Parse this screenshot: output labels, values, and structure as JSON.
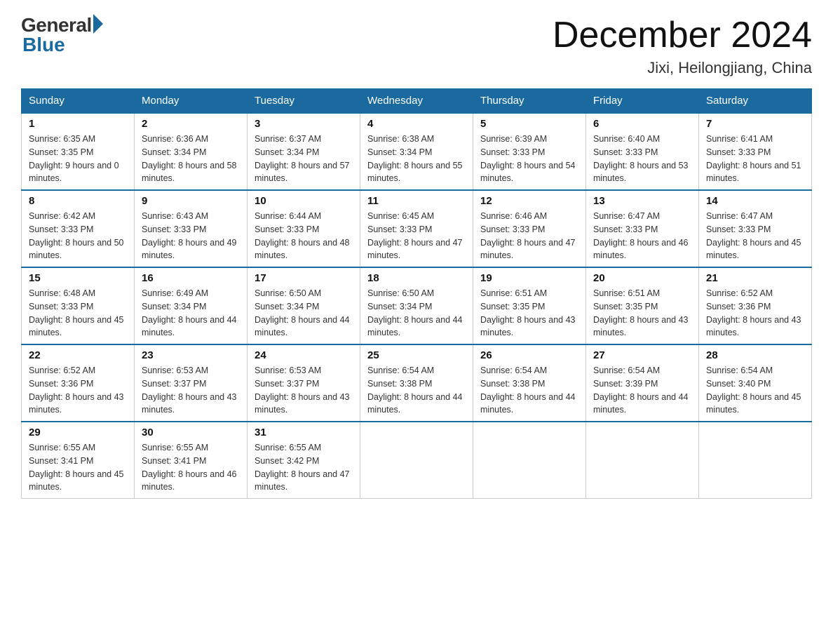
{
  "logo": {
    "general": "General",
    "blue": "Blue"
  },
  "title": "December 2024",
  "location": "Jixi, Heilongjiang, China",
  "weekdays": [
    "Sunday",
    "Monday",
    "Tuesday",
    "Wednesday",
    "Thursday",
    "Friday",
    "Saturday"
  ],
  "weeks": [
    [
      {
        "day": "1",
        "sunrise": "6:35 AM",
        "sunset": "3:35 PM",
        "daylight": "9 hours and 0 minutes."
      },
      {
        "day": "2",
        "sunrise": "6:36 AM",
        "sunset": "3:34 PM",
        "daylight": "8 hours and 58 minutes."
      },
      {
        "day": "3",
        "sunrise": "6:37 AM",
        "sunset": "3:34 PM",
        "daylight": "8 hours and 57 minutes."
      },
      {
        "day": "4",
        "sunrise": "6:38 AM",
        "sunset": "3:34 PM",
        "daylight": "8 hours and 55 minutes."
      },
      {
        "day": "5",
        "sunrise": "6:39 AM",
        "sunset": "3:33 PM",
        "daylight": "8 hours and 54 minutes."
      },
      {
        "day": "6",
        "sunrise": "6:40 AM",
        "sunset": "3:33 PM",
        "daylight": "8 hours and 53 minutes."
      },
      {
        "day": "7",
        "sunrise": "6:41 AM",
        "sunset": "3:33 PM",
        "daylight": "8 hours and 51 minutes."
      }
    ],
    [
      {
        "day": "8",
        "sunrise": "6:42 AM",
        "sunset": "3:33 PM",
        "daylight": "8 hours and 50 minutes."
      },
      {
        "day": "9",
        "sunrise": "6:43 AM",
        "sunset": "3:33 PM",
        "daylight": "8 hours and 49 minutes."
      },
      {
        "day": "10",
        "sunrise": "6:44 AM",
        "sunset": "3:33 PM",
        "daylight": "8 hours and 48 minutes."
      },
      {
        "day": "11",
        "sunrise": "6:45 AM",
        "sunset": "3:33 PM",
        "daylight": "8 hours and 47 minutes."
      },
      {
        "day": "12",
        "sunrise": "6:46 AM",
        "sunset": "3:33 PM",
        "daylight": "8 hours and 47 minutes."
      },
      {
        "day": "13",
        "sunrise": "6:47 AM",
        "sunset": "3:33 PM",
        "daylight": "8 hours and 46 minutes."
      },
      {
        "day": "14",
        "sunrise": "6:47 AM",
        "sunset": "3:33 PM",
        "daylight": "8 hours and 45 minutes."
      }
    ],
    [
      {
        "day": "15",
        "sunrise": "6:48 AM",
        "sunset": "3:33 PM",
        "daylight": "8 hours and 45 minutes."
      },
      {
        "day": "16",
        "sunrise": "6:49 AM",
        "sunset": "3:34 PM",
        "daylight": "8 hours and 44 minutes."
      },
      {
        "day": "17",
        "sunrise": "6:50 AM",
        "sunset": "3:34 PM",
        "daylight": "8 hours and 44 minutes."
      },
      {
        "day": "18",
        "sunrise": "6:50 AM",
        "sunset": "3:34 PM",
        "daylight": "8 hours and 44 minutes."
      },
      {
        "day": "19",
        "sunrise": "6:51 AM",
        "sunset": "3:35 PM",
        "daylight": "8 hours and 43 minutes."
      },
      {
        "day": "20",
        "sunrise": "6:51 AM",
        "sunset": "3:35 PM",
        "daylight": "8 hours and 43 minutes."
      },
      {
        "day": "21",
        "sunrise": "6:52 AM",
        "sunset": "3:36 PM",
        "daylight": "8 hours and 43 minutes."
      }
    ],
    [
      {
        "day": "22",
        "sunrise": "6:52 AM",
        "sunset": "3:36 PM",
        "daylight": "8 hours and 43 minutes."
      },
      {
        "day": "23",
        "sunrise": "6:53 AM",
        "sunset": "3:37 PM",
        "daylight": "8 hours and 43 minutes."
      },
      {
        "day": "24",
        "sunrise": "6:53 AM",
        "sunset": "3:37 PM",
        "daylight": "8 hours and 43 minutes."
      },
      {
        "day": "25",
        "sunrise": "6:54 AM",
        "sunset": "3:38 PM",
        "daylight": "8 hours and 44 minutes."
      },
      {
        "day": "26",
        "sunrise": "6:54 AM",
        "sunset": "3:38 PM",
        "daylight": "8 hours and 44 minutes."
      },
      {
        "day": "27",
        "sunrise": "6:54 AM",
        "sunset": "3:39 PM",
        "daylight": "8 hours and 44 minutes."
      },
      {
        "day": "28",
        "sunrise": "6:54 AM",
        "sunset": "3:40 PM",
        "daylight": "8 hours and 45 minutes."
      }
    ],
    [
      {
        "day": "29",
        "sunrise": "6:55 AM",
        "sunset": "3:41 PM",
        "daylight": "8 hours and 45 minutes."
      },
      {
        "day": "30",
        "sunrise": "6:55 AM",
        "sunset": "3:41 PM",
        "daylight": "8 hours and 46 minutes."
      },
      {
        "day": "31",
        "sunrise": "6:55 AM",
        "sunset": "3:42 PM",
        "daylight": "8 hours and 47 minutes."
      },
      null,
      null,
      null,
      null
    ]
  ]
}
